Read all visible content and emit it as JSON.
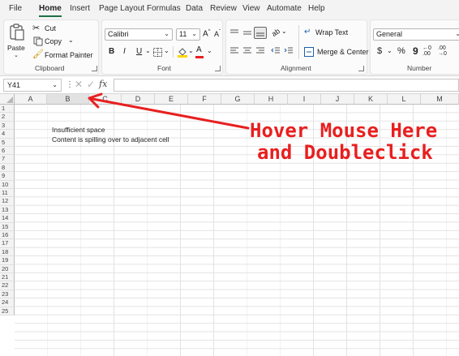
{
  "menu": {
    "tabs": [
      "File",
      "Home",
      "Insert",
      "Page Layout",
      "Formulas",
      "Data",
      "Review",
      "View",
      "Automate",
      "Help"
    ],
    "active": "Home"
  },
  "ribbon": {
    "clipboard": {
      "paste_label": "Paste",
      "cut_label": "Cut",
      "copy_label": "Copy",
      "format_painter_label": "Format Painter",
      "group_label": "Clipboard"
    },
    "font": {
      "font_name": "Calibri",
      "font_size": "11",
      "grow_label": "A",
      "shrink_label": "A",
      "bold_label": "B",
      "italic_label": "I",
      "underline_label": "U",
      "font_color_label": "A",
      "group_label": "Font"
    },
    "alignment": {
      "wrap_text_label": "Wrap Text",
      "merge_center_label": "Merge & Center",
      "group_label": "Alignment"
    },
    "number": {
      "format": "General",
      "currency_label": "$",
      "percent_label": "%",
      "comma_label": "9",
      "group_label": "Number"
    }
  },
  "formula_bar": {
    "name_box": "Y41",
    "fx_label": "fx",
    "formula": ""
  },
  "sheet": {
    "columns": [
      "A",
      "B",
      "C",
      "D",
      "E",
      "F",
      "G",
      "H",
      "I",
      "J",
      "K",
      "L",
      "M"
    ],
    "rows": [
      "1",
      "2",
      "3",
      "4",
      "5",
      "6",
      "7",
      "8",
      "9",
      "10",
      "11",
      "12",
      "13",
      "14",
      "15",
      "16",
      "17",
      "18",
      "19",
      "20",
      "21",
      "22",
      "23",
      "24",
      "25"
    ],
    "cells": {
      "B3": "Insufficient space",
      "B4": "Content is spilling over to adjacent cell"
    }
  },
  "annotation": {
    "line1": "Hover Mouse Here",
    "line2": "and Doubleclick",
    "color": "#e81f1f"
  },
  "colors": {
    "accent": "#1e7145",
    "highlight_yellow": "#ffd500",
    "font_red": "#e81f1f"
  }
}
